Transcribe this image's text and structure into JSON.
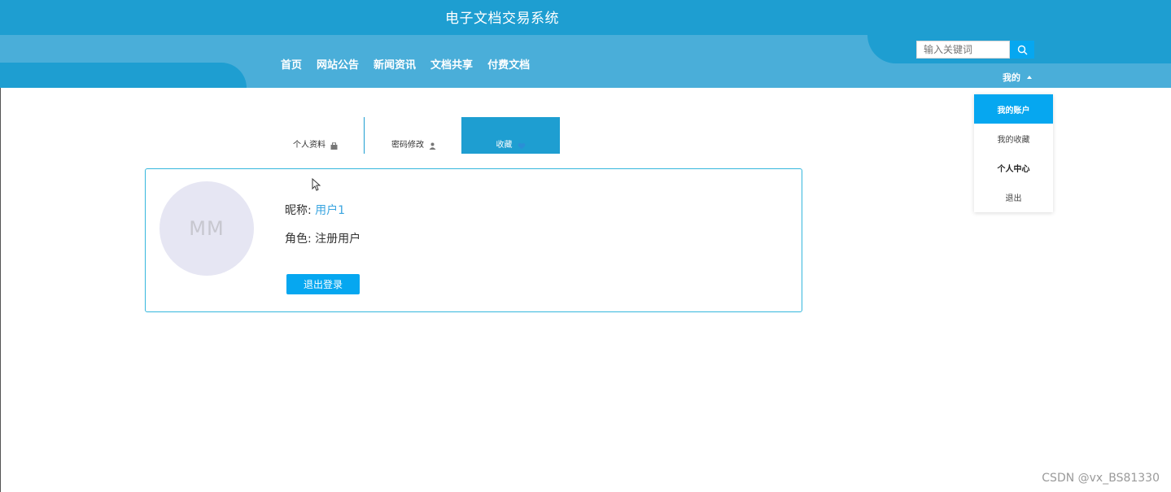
{
  "site": {
    "title": "电子文档交易系统"
  },
  "nav": {
    "items": [
      {
        "label": "首页"
      },
      {
        "label": "网站公告"
      },
      {
        "label": "新闻资讯"
      },
      {
        "label": "文档共享"
      },
      {
        "label": "付费文档"
      }
    ]
  },
  "search": {
    "placeholder": "输入关键词",
    "icon": "search-icon"
  },
  "user_menu": {
    "label": "我的",
    "items": [
      {
        "label": "我的账户",
        "active": true
      },
      {
        "label": "我的收藏"
      },
      {
        "label": "个人中心"
      },
      {
        "label": "退出"
      }
    ]
  },
  "tabs": [
    {
      "label": "个人资料",
      "icon": "bag-icon"
    },
    {
      "label": "密码修改",
      "icon": "user-icon"
    },
    {
      "label": "收藏",
      "icon": "heart-icon",
      "active": true
    }
  ],
  "profile": {
    "avatar_initials": "MM",
    "nickname_label": "昵称:",
    "nickname_value": "用户1",
    "role_label": "角色:",
    "role_value": "注册用户",
    "logout_label": "退出登录"
  },
  "watermark": "CSDN @vx_BS81330",
  "colors": {
    "header_dark": "#1e9ed1",
    "header_light": "#4aaed9",
    "accent": "#06a7f0",
    "card_border": "#35b7dd"
  }
}
